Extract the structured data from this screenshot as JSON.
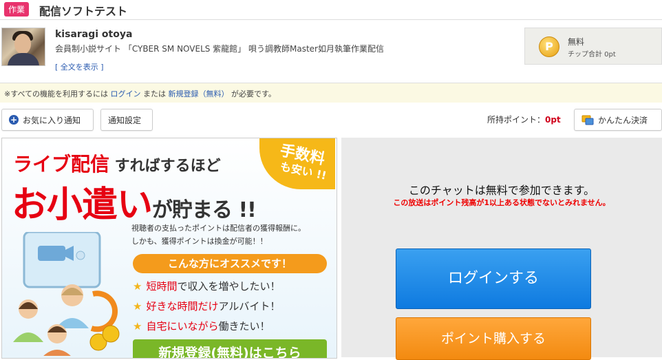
{
  "header": {
    "tag": "作業",
    "title": "配信ソフトテスト"
  },
  "profile": {
    "name": "kisaragi otoya",
    "description": "会員制小説サイト 「CYBER SM NOVELS 紫龍館」 唄う調教師Master如月執筆作業配信",
    "show_full": "[ 全文を表示 ]"
  },
  "fee": {
    "label": "無料",
    "chip_total": "チップ合計 0pt",
    "coin_letter": "P"
  },
  "notice": {
    "prefix": "※すべての機能を利用するには ",
    "login": "ログイン",
    "or": " または ",
    "register": "新規登録（無料）",
    "suffix": " が必要です。"
  },
  "actions": {
    "favorite": "お気に入り通知",
    "notify_settings": "通知設定",
    "points_label": "所持ポイント：",
    "points_value": "0pt",
    "easy_pay": "かんたん決済"
  },
  "banner": {
    "line1_red": "ライブ配信",
    "line1_rest": " すればするほど",
    "line2_red": "お小遣い",
    "line2_rest": "が貯まる !!",
    "badge_line1": "手数料",
    "badge_line2": "も安い !!",
    "desc_line1": "視聴者の支払ったポイントは配信者の獲得報酬に。",
    "desc_line2": "しかも、獲得ポイントは換金が可能！！",
    "recommend": "こんな方にオススメです！",
    "features": [
      {
        "highlight": "短時間",
        "rest": "で収入を増やしたい！"
      },
      {
        "highlight": "好きな時間だけ",
        "rest": "アルバイト！"
      },
      {
        "highlight": "自宅にいながら",
        "rest": "働きたい！"
      }
    ],
    "register_button": "新規登録(無料)はこちら"
  },
  "chat": {
    "free_text": "このチャットは無料で参加できます。",
    "warning": "この放送はポイント残高が1以上ある状態でないとみれません。",
    "login_button": "ログインする",
    "buy_button": "ポイント購入する"
  },
  "colors": {
    "accent_pink": "#e8336d",
    "link_blue": "#2a5bb0",
    "login_blue": "#1a8ae8",
    "buy_orange": "#f7961f",
    "warn_red": "#e00000"
  }
}
